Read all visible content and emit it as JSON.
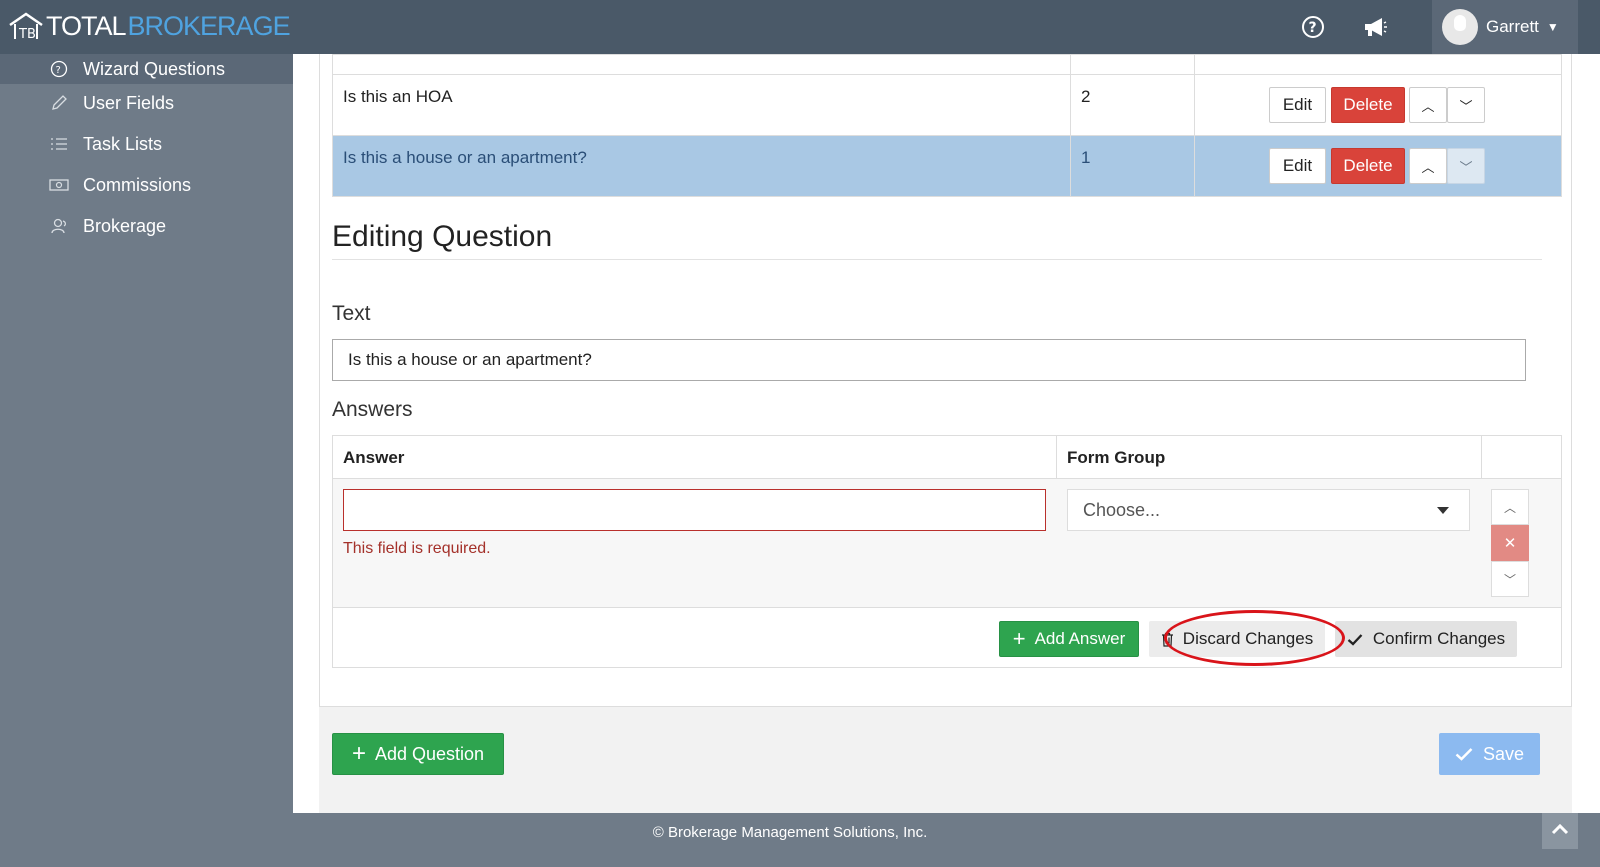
{
  "brand": {
    "part1": "TOTAL",
    "part2": "BROKERAGE"
  },
  "topbar": {
    "user_name": "Garrett",
    "help_icon": "help-circle-icon",
    "announce_icon": "megaphone-icon"
  },
  "sidebar": {
    "items": [
      {
        "label": "Wizard Questions",
        "icon": "question-circle-icon"
      },
      {
        "label": "User Fields",
        "icon": "pencil-icon"
      },
      {
        "label": "Task Lists",
        "icon": "list-icon"
      },
      {
        "label": "Commissions",
        "icon": "money-icon"
      },
      {
        "label": "Brokerage",
        "icon": "users-icon"
      }
    ]
  },
  "questions": {
    "rows": [
      {
        "text": "Is this an HOA",
        "order": "2"
      },
      {
        "text": "Is this a house or an apartment?",
        "order": "1"
      }
    ],
    "edit_label": "Edit",
    "delete_label": "Delete"
  },
  "editor": {
    "title": "Editing Question",
    "text_label": "Text",
    "text_value": "Is this a house or an apartment?",
    "answers_label": "Answers",
    "col_answer": "Answer",
    "col_form_group": "Form Group",
    "answer_value": "",
    "error": "This field is required.",
    "select_value": "Choose...",
    "add_answer": "Add Answer",
    "discard": "Discard Changes",
    "confirm": "Confirm Changes"
  },
  "footer_actions": {
    "add_question": "Add Question",
    "save": "Save"
  },
  "footer": {
    "copyright": "© Brokerage Management Solutions, Inc."
  },
  "colors": {
    "primary_green": "#2ea44f",
    "danger": "#d9433a",
    "nav": "#4a5968",
    "selected_row": "#a9c8e4"
  }
}
